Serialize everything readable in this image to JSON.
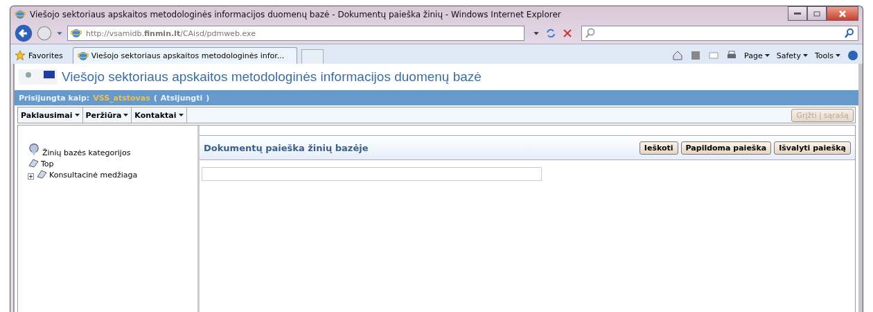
{
  "window": {
    "title": "Viešojo sektoriaus apskaitos metodologinės informacijos duomenų bazė - Dokumentų paieška žinių  - Windows Internet Explorer"
  },
  "address_bar": {
    "url": "http://vsamidb.**finmin.lt**/CAisd/pdmweb.exe"
  },
  "favorites": "Favorites",
  "tabs": [
    {
      "label": "Viešojo sektoriaus apskaitos metodologinės infor...",
      "selected": true
    }
  ],
  "command_bar": [
    "Page",
    "Safety",
    "Tools"
  ],
  "page": {
    "header": "Viešojo sektoriaus apskaitos metodologinės informacijos duomenų bazė",
    "login": {
      "label": "Prisijungta kaip:",
      "user": "VSS_atstovas",
      "open": "(",
      "logout": "Atsijungti",
      "close": ")"
    },
    "menu": [
      {
        "label": "Paklausimai"
      },
      {
        "label": "Peržiūra"
      },
      {
        "label": "Kontaktai"
      }
    ],
    "back_button": {
      "label": "Grįžti į sąrašą",
      "disabled": true
    },
    "tree": {
      "root": "Žinių bazės kategorijos",
      "items": [
        {
          "label": "Top"
        },
        {
          "label": "Konsultacinė medžiaga",
          "expanded": false
        }
      ]
    },
    "search": {
      "title": "Dokumentų paieška žinių bazėje",
      "buttons": [
        "Ieškoti",
        "Papildoma paieška",
        "Išvalyti paiešką"
      ]
    }
  }
}
